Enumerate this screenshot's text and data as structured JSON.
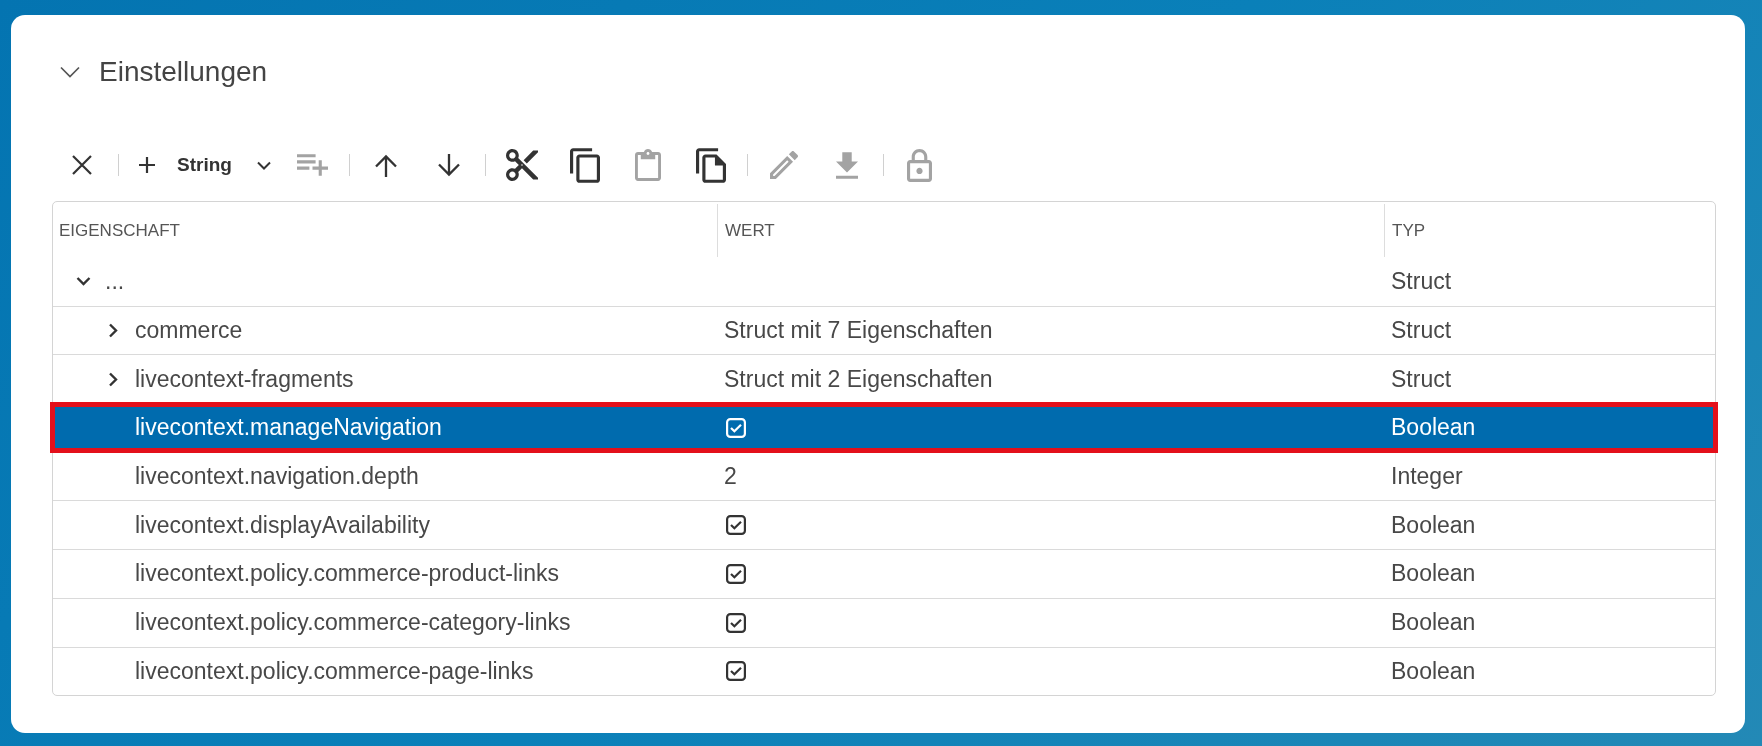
{
  "section": {
    "title": "Einstellungen",
    "expanded": true
  },
  "toolbar": {
    "groups": [
      {
        "buttons": [
          {
            "kind": "icon",
            "disabled": false
          }
        ]
      },
      {
        "buttons": [
          {
            "kind": "split",
            "label": "String",
            "disabled": false
          },
          {
            "kind": "icon",
            "disabled": true
          }
        ]
      },
      {
        "buttons": [
          {
            "kind": "icon",
            "disabled": false
          },
          {
            "kind": "icon",
            "disabled": false
          }
        ]
      },
      {
        "buttons": [
          {
            "kind": "icon",
            "disabled": false
          },
          {
            "kind": "icon",
            "disabled": false
          },
          {
            "kind": "icon",
            "disabled": true
          },
          {
            "kind": "icon",
            "disabled": false
          }
        ]
      },
      {
        "buttons": [
          {
            "kind": "icon",
            "disabled": true
          },
          {
            "kind": "icon",
            "disabled": true
          }
        ]
      },
      {
        "buttons": [
          {
            "kind": "icon",
            "disabled": true
          }
        ]
      }
    ]
  },
  "table": {
    "columns": [
      "EIGENSCHAFT",
      "WERT",
      "TYP"
    ],
    "rows": [
      {
        "name": "...",
        "expanded": true,
        "type": "Struct",
        "selected": false,
        "highlighted": false,
        "children": [
          {
            "name": "commerce",
            "expanded": false,
            "value": {
              "kind": "text",
              "text": "Struct mit 7 Eigenschaften"
            },
            "type": "Struct",
            "selected": false,
            "highlighted": false
          },
          {
            "name": "livecontext-fragments",
            "expanded": false,
            "value": {
              "kind": "text",
              "text": "Struct mit 2 Eigenschaften"
            },
            "type": "Struct",
            "selected": false,
            "highlighted": false
          },
          {
            "name": "livecontext.manageNavigation",
            "value": {
              "kind": "checkbox",
              "checked": true
            },
            "type": "Boolean",
            "selected": true,
            "highlighted": true
          },
          {
            "name": "livecontext.navigation.depth",
            "value": {
              "kind": "text",
              "text": "2"
            },
            "type": "Integer",
            "selected": false,
            "highlighted": false
          },
          {
            "name": "livecontext.displayAvailability",
            "value": {
              "kind": "checkbox",
              "checked": true
            },
            "type": "Boolean",
            "selected": false,
            "highlighted": false
          },
          {
            "name": "livecontext.policy.commerce-product-links",
            "value": {
              "kind": "checkbox",
              "checked": true
            },
            "type": "Boolean",
            "selected": false,
            "highlighted": false
          },
          {
            "name": "livecontext.policy.commerce-category-links",
            "value": {
              "kind": "checkbox",
              "checked": true
            },
            "type": "Boolean",
            "selected": false,
            "highlighted": false
          },
          {
            "name": "livecontext.policy.commerce-page-links",
            "value": {
              "kind": "checkbox",
              "checked": true
            },
            "type": "Boolean",
            "selected": false,
            "highlighted": false
          }
        ]
      }
    ]
  }
}
